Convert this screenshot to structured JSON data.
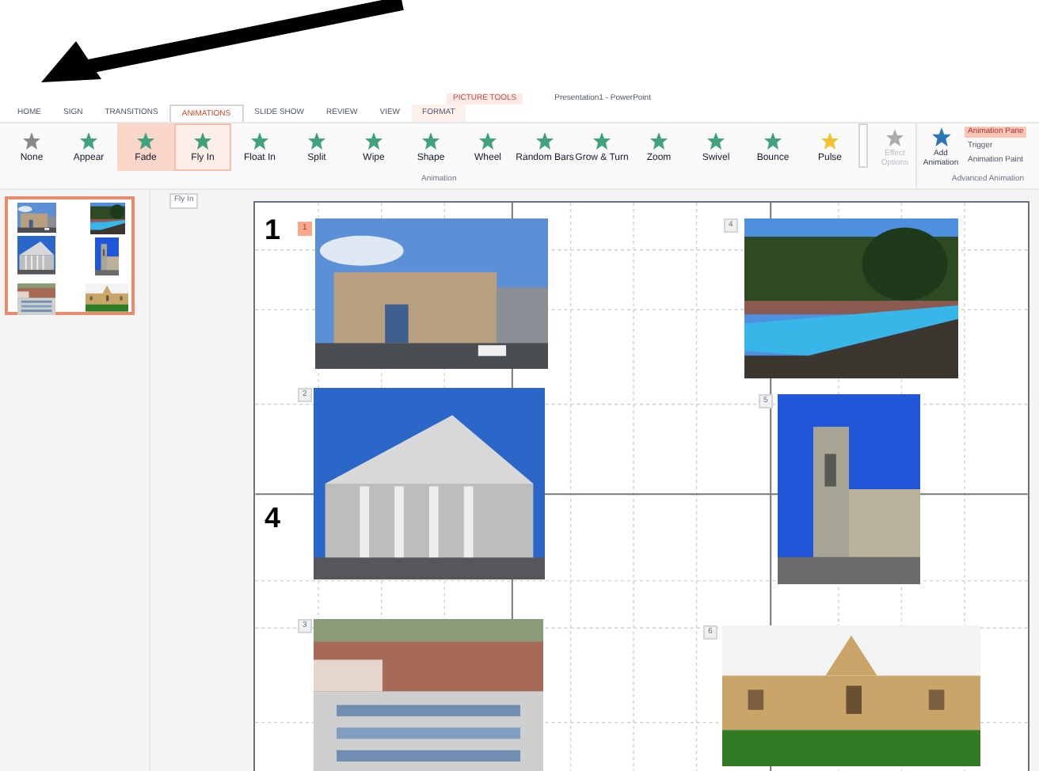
{
  "title_bar": {
    "contextual_group": "PICTURE TOOLS",
    "title": "Presentation1 - PowerPoint"
  },
  "tabs": [
    {
      "label": "HOME",
      "selected": false,
      "contextual": false
    },
    {
      "label": "SIGN",
      "selected": false,
      "contextual": false
    },
    {
      "label": "TRANSITIONS",
      "selected": false,
      "contextual": false
    },
    {
      "label": "ANIMATIONS",
      "selected": true,
      "contextual": false
    },
    {
      "label": "SLIDE SHOW",
      "selected": false,
      "contextual": false
    },
    {
      "label": "REVIEW",
      "selected": false,
      "contextual": false
    },
    {
      "label": "VIEW",
      "selected": false,
      "contextual": false
    },
    {
      "label": "FORMAT",
      "selected": false,
      "contextual": true
    }
  ],
  "animation_gallery": [
    {
      "label": "None",
      "kind": "none",
      "selected": false,
      "hovered": false
    },
    {
      "label": "Appear",
      "kind": "entrance",
      "selected": false,
      "hovered": false
    },
    {
      "label": "Fade",
      "kind": "entrance",
      "selected": true,
      "hovered": false
    },
    {
      "label": "Fly In",
      "kind": "entrance",
      "selected": false,
      "hovered": true
    },
    {
      "label": "Float In",
      "kind": "entrance",
      "selected": false,
      "hovered": false
    },
    {
      "label": "Split",
      "kind": "entrance",
      "selected": false,
      "hovered": false
    },
    {
      "label": "Wipe",
      "kind": "entrance",
      "selected": false,
      "hovered": false
    },
    {
      "label": "Shape",
      "kind": "entrance",
      "selected": false,
      "hovered": false
    },
    {
      "label": "Wheel",
      "kind": "entrance",
      "selected": false,
      "hovered": false
    },
    {
      "label": "Random Bars",
      "kind": "entrance",
      "selected": false,
      "hovered": false
    },
    {
      "label": "Grow & Turn",
      "kind": "entrance",
      "selected": false,
      "hovered": false
    },
    {
      "label": "Zoom",
      "kind": "entrance",
      "selected": false,
      "hovered": false
    },
    {
      "label": "Swivel",
      "kind": "entrance",
      "selected": false,
      "hovered": false
    },
    {
      "label": "Bounce",
      "kind": "entrance",
      "selected": false,
      "hovered": false
    },
    {
      "label": "Pulse",
      "kind": "emphasis",
      "selected": false,
      "hovered": false
    }
  ],
  "effect_options": {
    "label": "Effect Options",
    "disabled": true
  },
  "add_animation": {
    "label": "Add Animation"
  },
  "advanced": [
    {
      "label": "Animation Pane",
      "highlighted": true
    },
    {
      "label": "Trigger",
      "highlighted": false
    },
    {
      "label": "Animation Paint",
      "highlighted": false
    }
  ],
  "group_labels": [
    "Animation",
    "Advanced Animation"
  ],
  "tooltip": "Fly In",
  "thumbnail": {
    "selected": true
  },
  "slide": {
    "labels": [
      "1",
      "4"
    ],
    "pictures": [
      {
        "badge": "1",
        "selected": true
      },
      {
        "badge": "4",
        "selected": false
      },
      {
        "badge": "2",
        "selected": false
      },
      {
        "badge": "5",
        "selected": false
      },
      {
        "badge": "3",
        "selected": false
      },
      {
        "badge": "6",
        "selected": false
      }
    ]
  }
}
